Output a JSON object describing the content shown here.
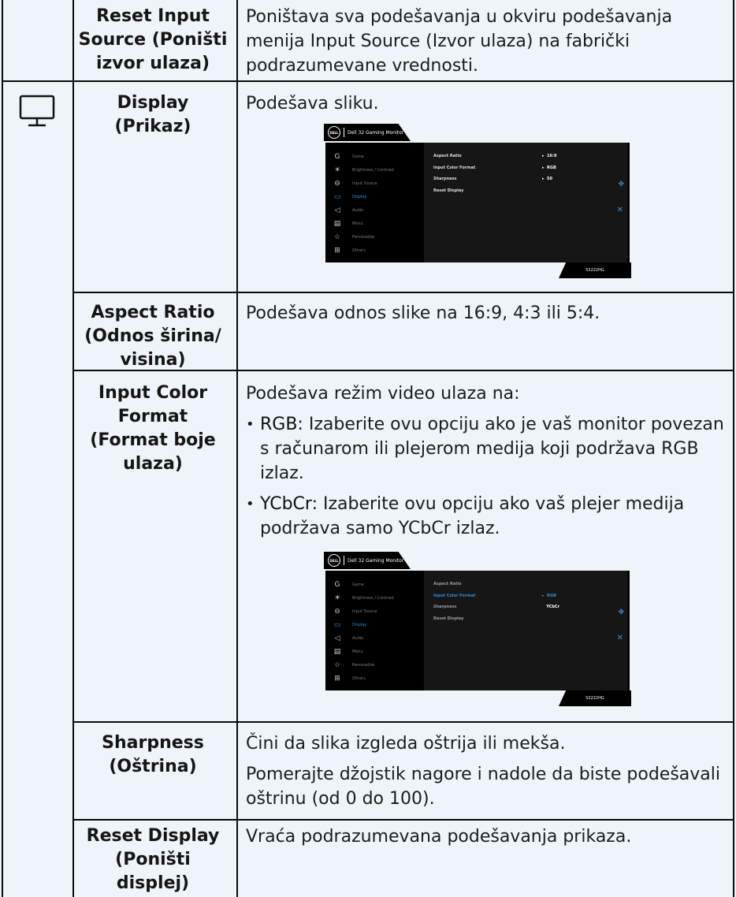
{
  "rows": [
    {
      "label": [
        "Reset Input",
        "Source (Poništi",
        "izvor ulaza)"
      ],
      "desc": "Poništava sva podešavanja u okviru podešavanja menija Input Source (Izvor ulaza) na fabrički podrazumevane vrednosti."
    },
    {
      "icon": "monitor-icon",
      "label": [
        "Display",
        "(Prikaz)"
      ],
      "desc": "Podešava sliku."
    },
    {
      "label": [
        "Aspect Ratio",
        "(Odnos širina/",
        "visina)"
      ],
      "desc": "Podešava odnos slike na 16:9, 4:3 ili 5:4."
    },
    {
      "label": [
        "Input Color",
        "Format",
        "(Format boje",
        "ulaza)"
      ],
      "intro": "Podešava režim video ulaza na:",
      "bullets": [
        {
          "term": "RGB:",
          "text": " Izaberite ovu opciju ako je vaš monitor povezan s računarom ili plejerom medija koji podržava RGB izlaz."
        },
        {
          "term": "YCbCr:",
          "text": " Izaberite ovu opciju ako vaš plejer medija podržava samo YCbCr izlaz."
        }
      ]
    },
    {
      "label": [
        "Sharpness",
        "(Oštrina)"
      ],
      "desc": "Čini da slika izgleda oštrija ili mekša.",
      "desc2": "Pomerajte džojstik nagore i nadole da biste podešavali oštrinu (od 0 do 100)."
    },
    {
      "label": [
        "Reset Display",
        "(Poništi",
        "displej)"
      ],
      "desc": "Vraća podrazumevana podešavanja prikaza."
    }
  ],
  "osd": {
    "logo": "DELL",
    "title": "Dell 32 Gaming Monitor",
    "model": "S3222HG",
    "menu": [
      {
        "icon": "game-icon",
        "glyph": "G",
        "label": "Game"
      },
      {
        "icon": "brightness-icon",
        "glyph": "☀",
        "label": "Brightness / Contrast"
      },
      {
        "icon": "input-source-icon",
        "glyph": "⊖",
        "label": "Input Source"
      },
      {
        "icon": "display-icon",
        "glyph": "▭",
        "label": "Display"
      },
      {
        "icon": "audio-icon",
        "glyph": "◁",
        "label": "Audio"
      },
      {
        "icon": "menu-icon",
        "glyph": "▤",
        "label": "Menu"
      },
      {
        "icon": "personalize-icon",
        "glyph": "☆",
        "label": "Personalize"
      },
      {
        "icon": "others-icon",
        "glyph": "⊞",
        "label": "Others"
      }
    ],
    "screen1": [
      {
        "name": "Aspect Ratio",
        "value": "16:9"
      },
      {
        "name": "Input Color Format",
        "value": "RGB"
      },
      {
        "name": "Sharpness",
        "value": "50"
      },
      {
        "name": "Reset Display",
        "value": ""
      }
    ],
    "screen2": [
      {
        "name": "Aspect Ratio",
        "value": ""
      },
      {
        "name": "Input Color Format",
        "value": "RGB"
      },
      {
        "name": "Sharpness",
        "value": "YCbCr"
      },
      {
        "name": "Reset Display",
        "value": ""
      }
    ]
  }
}
